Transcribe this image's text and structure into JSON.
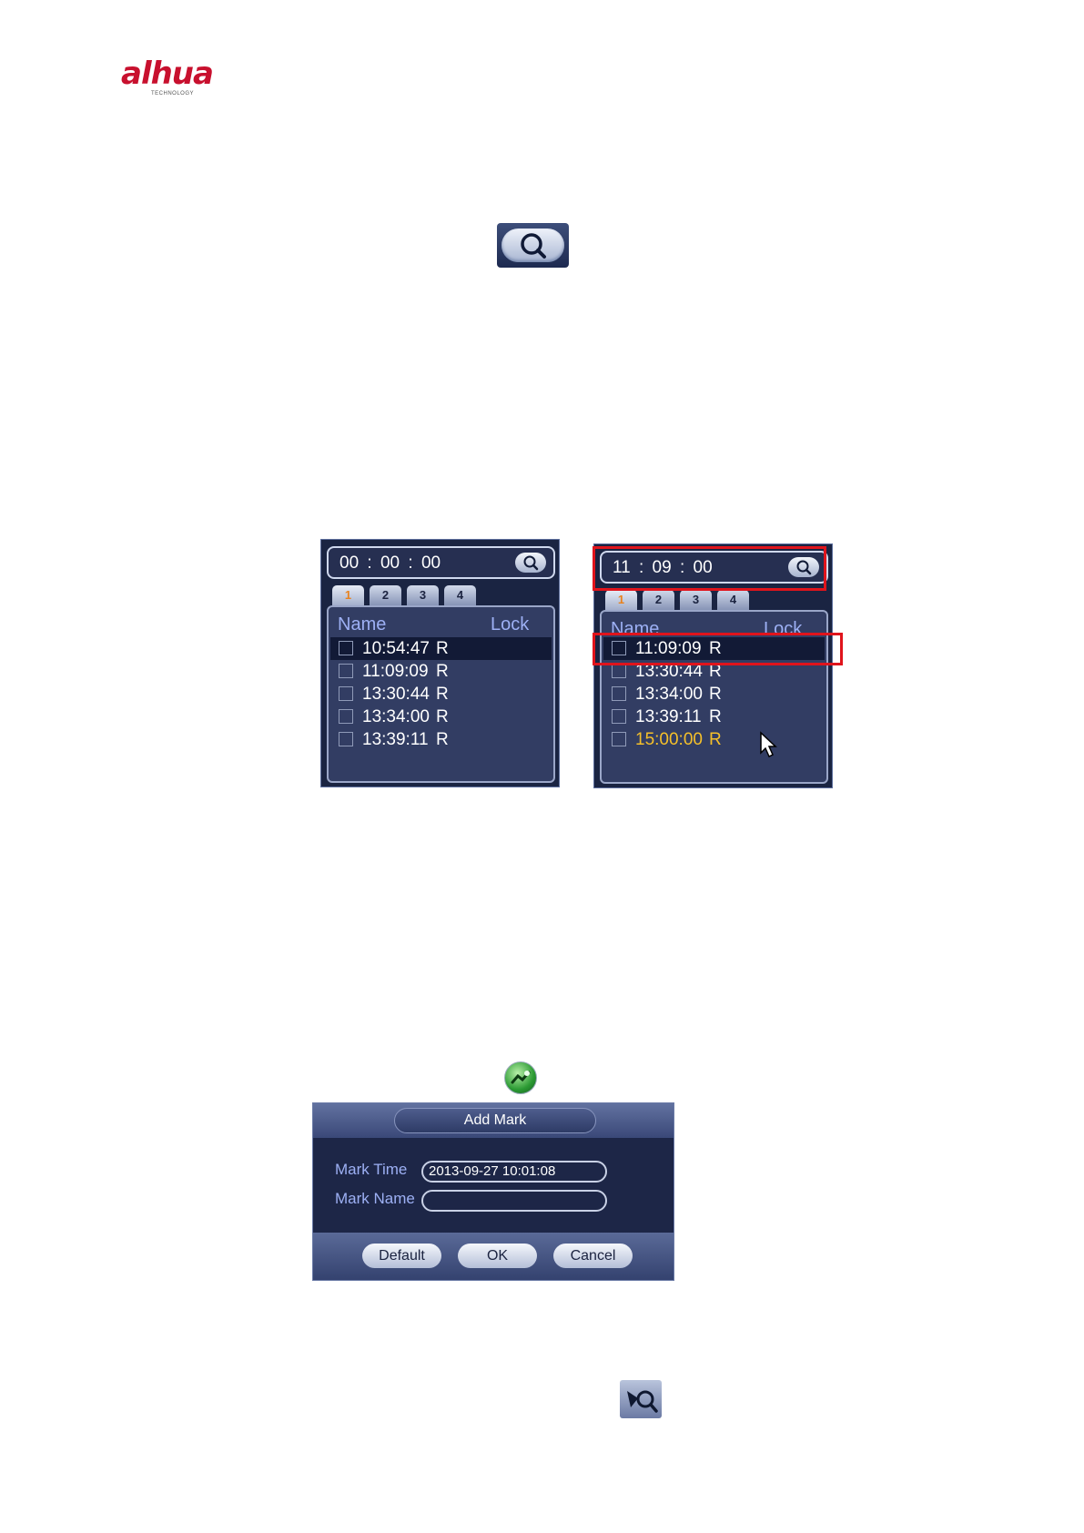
{
  "logo": {
    "main": "alhua",
    "sub": "TECHNOLOGY"
  },
  "icons": {
    "search": "search-icon",
    "add_mark": "add-mark-icon",
    "smart_search": "smart-search-icon"
  },
  "left_panel": {
    "time": "00 : 00 : 00",
    "tabs": [
      "1",
      "2",
      "3",
      "4"
    ],
    "header_name": "Name",
    "header_lock": "Lock",
    "rows": [
      {
        "time": "10:54:47",
        "lock": "R"
      },
      {
        "time": "11:09:09",
        "lock": "R"
      },
      {
        "time": "13:30:44",
        "lock": "R"
      },
      {
        "time": "13:34:00",
        "lock": "R"
      },
      {
        "time": "13:39:11",
        "lock": "R"
      }
    ]
  },
  "right_panel": {
    "time": "11 : 09 : 00",
    "tabs": [
      "1",
      "2",
      "3",
      "4"
    ],
    "header_name": "Name",
    "header_lock": "Lock",
    "rows": [
      {
        "time": "11:09:09",
        "lock": "R"
      },
      {
        "time": "13:30:44",
        "lock": "R"
      },
      {
        "time": "13:34:00",
        "lock": "R"
      },
      {
        "time": "13:39:11",
        "lock": "R"
      },
      {
        "time": "15:00:00",
        "lock": "R"
      }
    ]
  },
  "add_mark": {
    "title": "Add Mark",
    "mark_time_label": "Mark Time",
    "mark_time_value": "2013-09-27 10:01:08",
    "mark_name_label": "Mark Name",
    "mark_name_value": "",
    "buttons": {
      "default": "Default",
      "ok": "OK",
      "cancel": "Cancel"
    }
  },
  "colors": {
    "highlight": "#f5c02a",
    "accent_text": "#9db0f4",
    "annotation": "#e0141c"
  }
}
